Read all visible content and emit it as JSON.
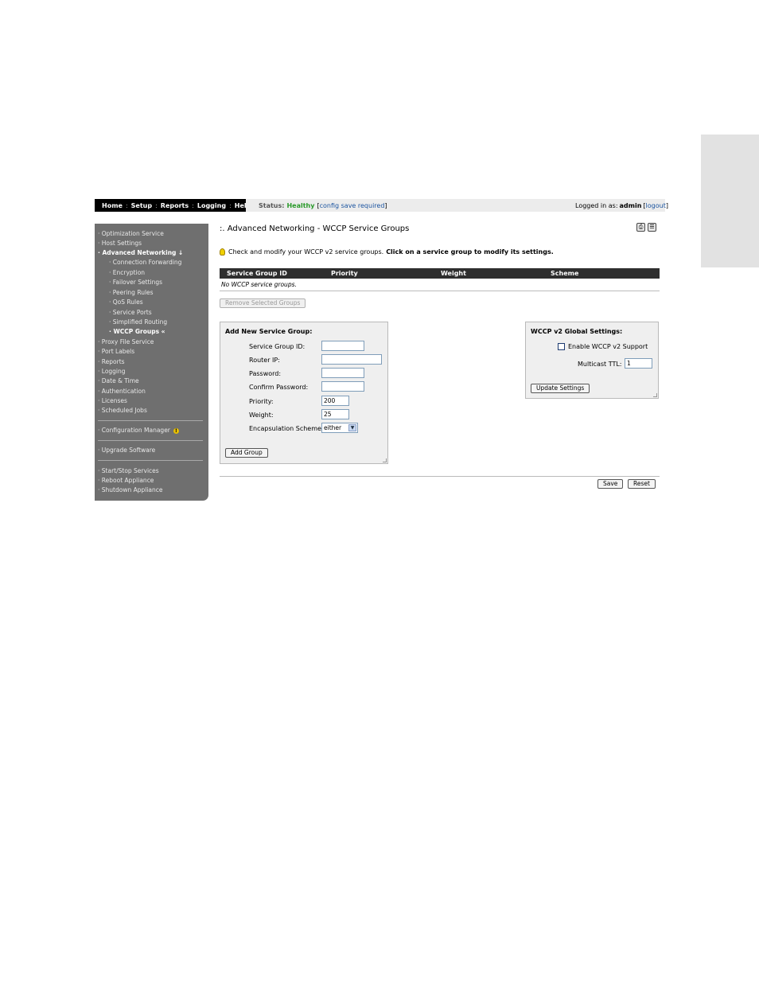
{
  "nav": {
    "items": [
      "Home",
      "Setup",
      "Reports",
      "Logging",
      "Help"
    ],
    "separator": ":"
  },
  "status": {
    "label": "Status:",
    "value": "Healthy",
    "config_open": "[",
    "config_link": "config save required",
    "config_close": "]"
  },
  "login": {
    "prefix": "Logged in as:",
    "user": "admin",
    "open": "[",
    "logout": "logout",
    "close": "]"
  },
  "sidebar": {
    "items": [
      {
        "label": "· Optimization Service"
      },
      {
        "label": "· Host Settings"
      },
      {
        "label": "· Advanced Networking ↓"
      },
      {
        "label": "· Connection Forwarding"
      },
      {
        "label": "· Encryption"
      },
      {
        "label": "· Failover Settings"
      },
      {
        "label": "· Peering Rules"
      },
      {
        "label": "· QoS Rules"
      },
      {
        "label": "· Service Ports"
      },
      {
        "label": "· Simplified Routing"
      },
      {
        "label": "· WCCP Groups «"
      },
      {
        "label": "· Proxy File Service"
      },
      {
        "label": "· Port Labels"
      },
      {
        "label": "· Reports"
      },
      {
        "label": "· Logging"
      },
      {
        "label": "· Date & Time"
      },
      {
        "label": "· Authentication"
      },
      {
        "label": "· Licenses"
      },
      {
        "label": "· Scheduled Jobs"
      },
      {
        "label": "· Configuration Manager"
      },
      {
        "label": "· Upgrade Software"
      },
      {
        "label": "· Start/Stop Services"
      },
      {
        "label": "· Reboot Appliance"
      },
      {
        "label": "· Shutdown Appliance"
      }
    ],
    "warn_glyph": "!"
  },
  "page": {
    "title": ":. Advanced Networking - WCCP Service Groups",
    "hint_plain": "Check and modify your WCCP v2 service groups.",
    "hint_bold": "Click on a service group to modify its settings."
  },
  "table": {
    "columns": [
      "Service Group ID",
      "Priority",
      "Weight",
      "Scheme"
    ],
    "empty_text": "No WCCP service groups."
  },
  "buttons": {
    "remove": "Remove Selected Groups",
    "add_group": "Add Group",
    "update_settings": "Update Settings",
    "save": "Save",
    "reset": "Reset"
  },
  "add_form": {
    "title": "Add New Service Group:",
    "fields": [
      {
        "label": "Service Group ID:",
        "value": ""
      },
      {
        "label": "Router IP:",
        "value": ""
      },
      {
        "label": "Password:",
        "value": ""
      },
      {
        "label": "Confirm Password:",
        "value": ""
      },
      {
        "label": "Priority:",
        "value": "200"
      },
      {
        "label": "Weight:",
        "value": "25"
      }
    ],
    "scheme_label": "Encapsulation Scheme:",
    "scheme_value": "either"
  },
  "global_settings": {
    "title": "WCCP v2 Global Settings:",
    "enable_label": "Enable WCCP v2 Support",
    "enabled": false,
    "ttl_label": "Multicast TTL:",
    "ttl_value": "1"
  }
}
